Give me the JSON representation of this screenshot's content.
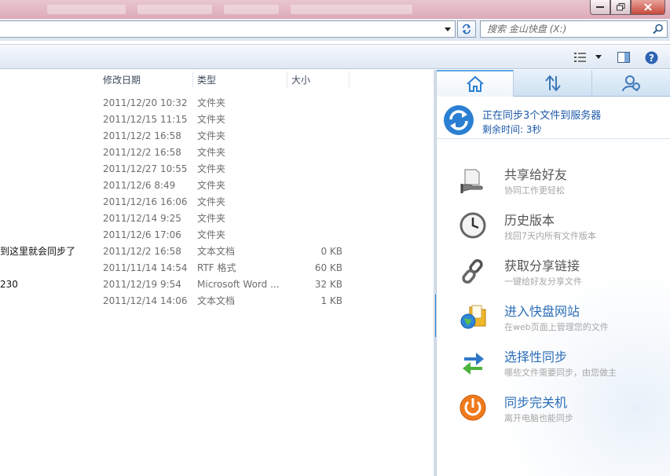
{
  "search": {
    "placeholder": "搜索 金山快盘 (X:)"
  },
  "columns": {
    "date": "修改日期",
    "type": "类型",
    "size": "大小"
  },
  "files": [
    {
      "name": "",
      "date": "2011/12/20 10:32",
      "type": "文件夹",
      "size": ""
    },
    {
      "name": "",
      "date": "2011/12/15 11:15",
      "type": "文件夹",
      "size": ""
    },
    {
      "name": "",
      "date": "2011/12/2 16:58",
      "type": "文件夹",
      "size": ""
    },
    {
      "name": "",
      "date": "2011/12/2 16:58",
      "type": "文件夹",
      "size": ""
    },
    {
      "name": "",
      "date": "2011/12/27 10:55",
      "type": "文件夹",
      "size": ""
    },
    {
      "name": "",
      "date": "2011/12/6 8:49",
      "type": "文件夹",
      "size": ""
    },
    {
      "name": "",
      "date": "2011/12/16 16:06",
      "type": "文件夹",
      "size": ""
    },
    {
      "name": "",
      "date": "2011/12/14 9:25",
      "type": "文件夹",
      "size": ""
    },
    {
      "name": "",
      "date": "2011/12/6 17:06",
      "type": "文件夹",
      "size": ""
    },
    {
      "name": "到这里就会同步了",
      "date": "2011/12/2 16:58",
      "type": "文本文档",
      "size": "0 KB"
    },
    {
      "name": "",
      "date": "2011/11/14 14:54",
      "type": "RTF 格式",
      "size": "60 KB"
    },
    {
      "name": "230",
      "date": "2011/12/19 9:54",
      "type": "Microsoft Word ...",
      "size": "32 KB"
    },
    {
      "name": "",
      "date": "2011/12/14 14:06",
      "type": "文本文档",
      "size": "1 KB"
    }
  ],
  "panel": {
    "tabs": [
      {
        "icon": "home-icon"
      },
      {
        "icon": "transfer-arrows-icon"
      },
      {
        "icon": "user-settings-icon"
      }
    ],
    "sync_status": {
      "line1": "正在同步3个文件到服务器",
      "line2": "剩余时间: 3秒"
    },
    "features": [
      {
        "icon": "share-hand-icon",
        "title": "共享给好友",
        "subtitle": "协同工作更轻松",
        "highlight": false
      },
      {
        "icon": "clock-icon",
        "title": "历史版本",
        "subtitle": "找回7天内所有文件版本",
        "highlight": false
      },
      {
        "icon": "chain-link-icon",
        "title": "获取分享链接",
        "subtitle": "一键给好友分享文件",
        "highlight": false
      },
      {
        "icon": "globe-folder-icon",
        "title": "进入快盘网站",
        "subtitle": "在web页面上管理您的文件",
        "highlight": true
      },
      {
        "icon": "selective-sync-icon",
        "title": "选择性同步",
        "subtitle": "哪些文件需要同步，由您做主",
        "highlight": true
      },
      {
        "icon": "power-icon",
        "title": "同步完关机",
        "subtitle": "离开电脑也能同步",
        "highlight": true
      }
    ]
  },
  "colors": {
    "accent": "#2a6db8",
    "sync_blue": "#1d5aa8",
    "panel_tab_border": "#5aa8e8",
    "collapse_tab": "#2a7fd2"
  }
}
